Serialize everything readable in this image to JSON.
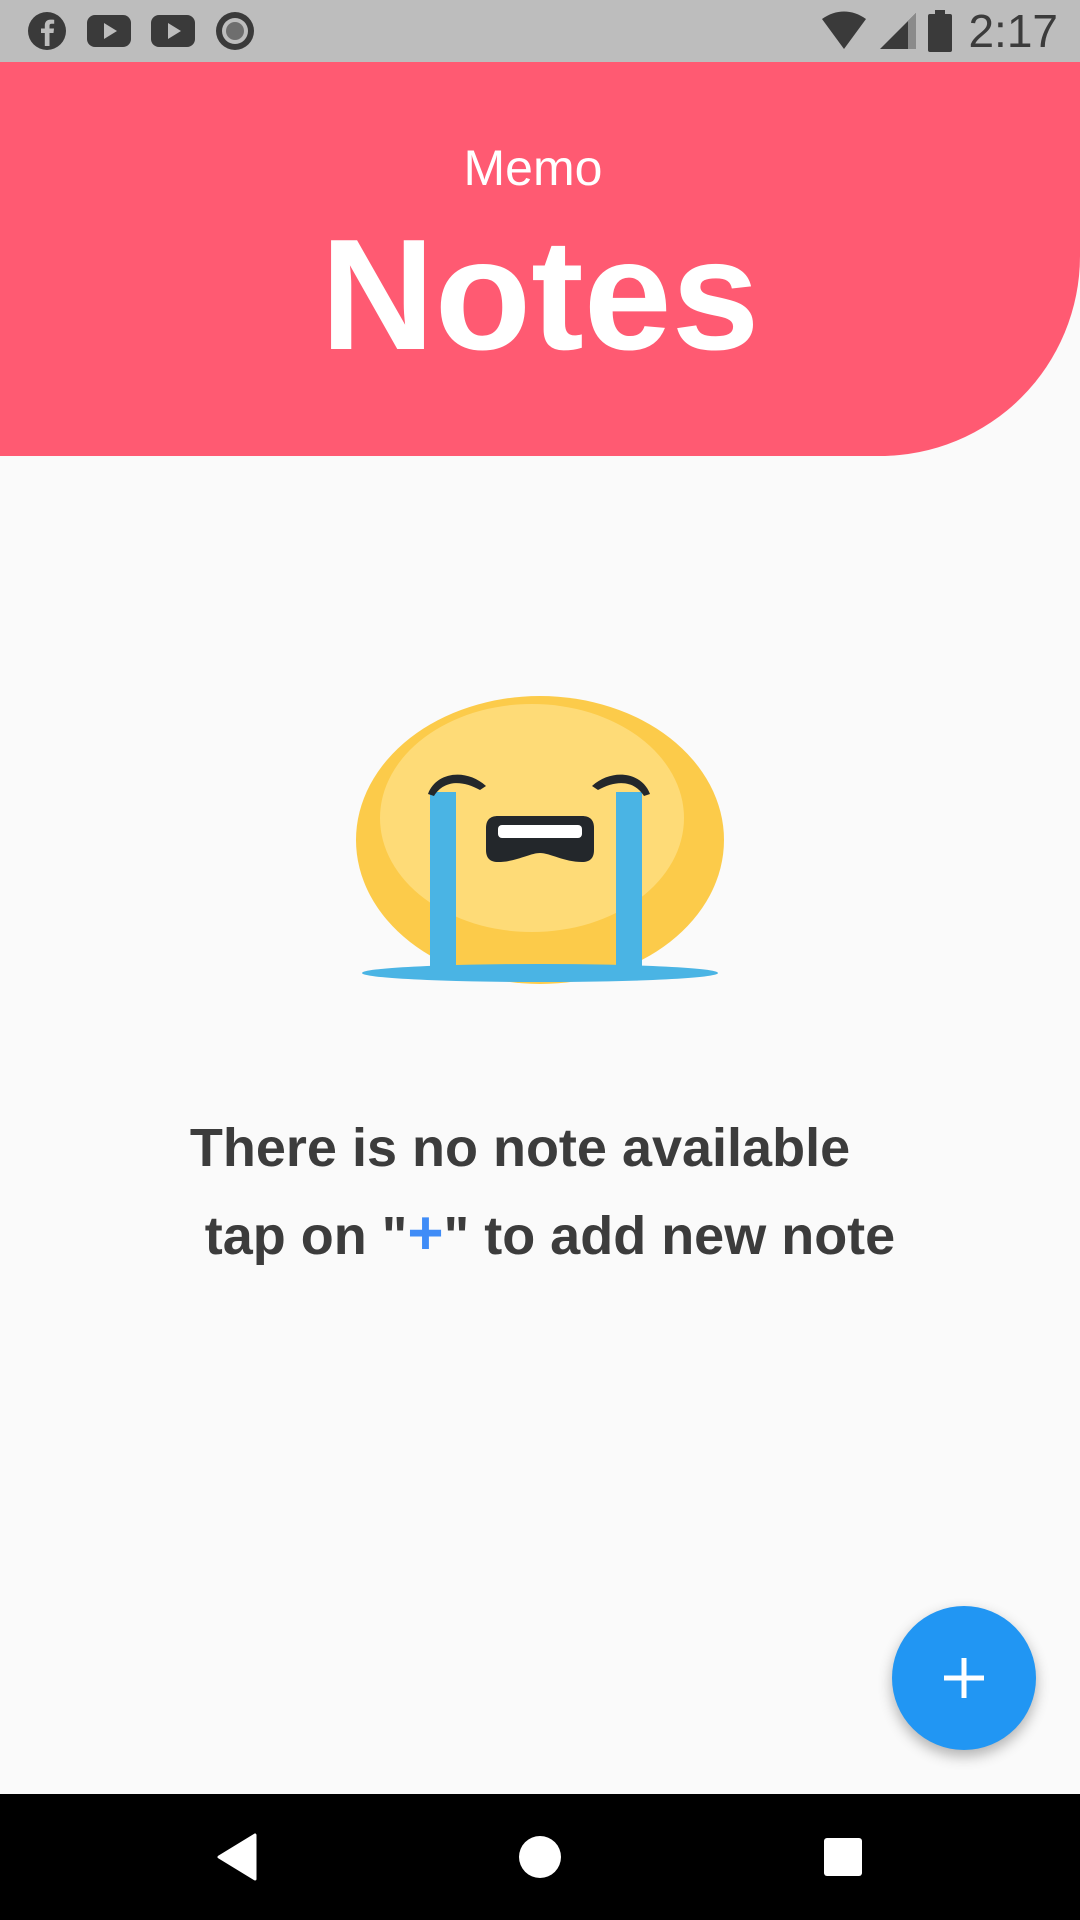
{
  "status_bar": {
    "time": "2:17",
    "notification_icons": [
      "facebook-icon",
      "youtube-icon",
      "youtube-icon",
      "record-icon"
    ],
    "system_icons": [
      "wifi-icon",
      "cell-signal-icon",
      "battery-icon"
    ]
  },
  "header": {
    "subtitle": "Memo",
    "title": "Notes",
    "color": "#ff5a72"
  },
  "empty_state": {
    "icon": "crying-face-emoji",
    "line1": "There is no note available",
    "line2_prefix": "tap on \"",
    "line2_icon": "+",
    "line2_suffix": "\" to add new note"
  },
  "fab": {
    "icon": "plus-icon",
    "color": "#2196f3"
  },
  "nav_bar": {
    "buttons": [
      "back-icon",
      "home-icon",
      "recents-icon"
    ]
  }
}
